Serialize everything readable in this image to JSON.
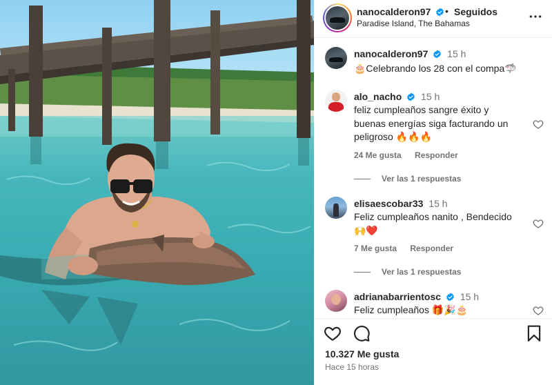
{
  "post": {
    "author": "nanocalderon97",
    "separator": "•",
    "follow_status": "Seguidos",
    "location": "Paradise Island, The Bahamas"
  },
  "caption": {
    "author": "nanocalderon97",
    "time": "15 h",
    "text": "🎂Celebrando los 28 con el compa🦈"
  },
  "comments": [
    {
      "author": "alo_nacho",
      "verified": true,
      "time": "15 h",
      "text": "feliz cumpleaños sangre éxito y buenas energías siga facturando un peligroso 🔥🔥🔥",
      "likes": "24 Me gusta",
      "reply_label": "Responder",
      "replies_label": "Ver las 1 respuestas"
    },
    {
      "author": "elisaescobar33",
      "verified": false,
      "time": "15 h",
      "text": "Feliz cumpleaños nanito , Bendecido 🙌❤️",
      "likes": "7 Me gusta",
      "reply_label": "Responder",
      "replies_label": "Ver las 1 respuestas"
    },
    {
      "author": "adrianabarrientosc",
      "verified": true,
      "time": "15 h",
      "text": "Feliz cumpleaños 🎁🎉🎂"
    }
  ],
  "footer": {
    "likes": "10.327 Me gusta",
    "time_ago": "Hace 15 horas"
  },
  "icons": {
    "more": "more-horizontal-icon",
    "like": "heart-icon",
    "comment": "comment-bubble-icon",
    "save": "bookmark-icon",
    "verified": "verified-badge-icon"
  },
  "colors": {
    "verified": "#0095f6",
    "text": "#262626",
    "muted": "#737373",
    "divider": "#efefef"
  }
}
